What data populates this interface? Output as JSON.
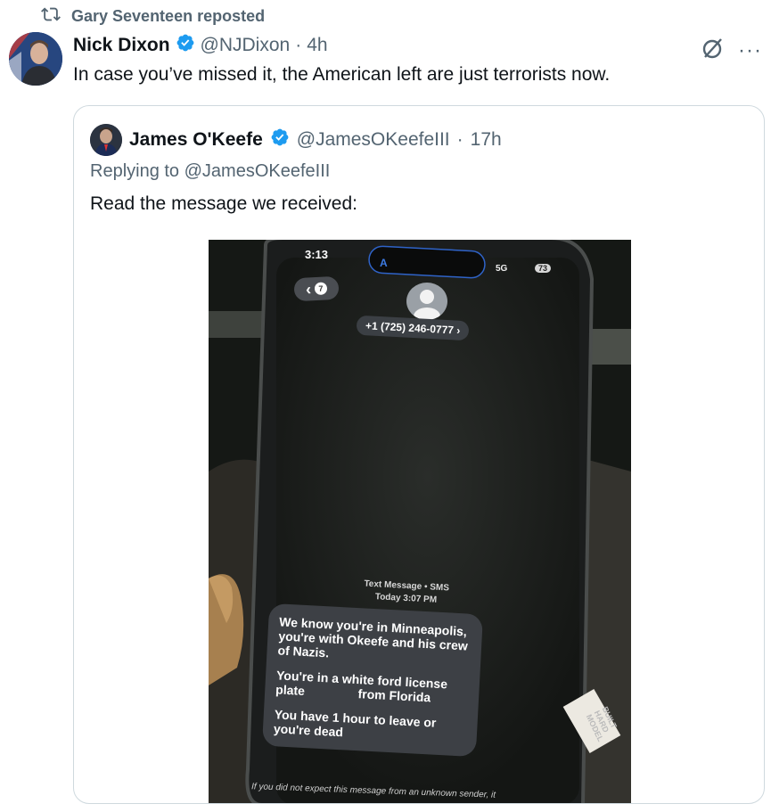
{
  "repost": {
    "label": "Gary Seventeen reposted",
    "icon": "repost-icon"
  },
  "tweet": {
    "author_name": "Nick Dixon",
    "handle": "@NJDixon",
    "separator": "·",
    "time": "4h",
    "text": "In case you’ve missed it, the American left are just terrorists now.",
    "more": "···"
  },
  "quote": {
    "author_name": "James O'Keefe",
    "handle": "@JamesOKeefeIII",
    "separator": "·",
    "time": "17h",
    "replying_prefix": "Replying to",
    "replying_handle": "@JamesOKeefeIII",
    "text": "Read the message we received:"
  },
  "photo": {
    "status_time": "3:13",
    "status_signal": "5G",
    "battery": "73",
    "back_count": "7",
    "phone_number": "+1 (725) 246-0777 ›",
    "meta_line1": "Text Message • SMS",
    "meta_line2": "Today 3:07 PM",
    "message_p1": "We know you're in Minneapolis, you're with Okeefe and his crew of Nazis.",
    "message_p2a": "You're in a white ford license plate",
    "message_p2b": "from Florida",
    "message_p3": "You have 1 hour to leave or you're dead",
    "footer": "If you did not expect this message from an unknown sender, it",
    "side_label": "BUILT HARD MODEL"
  },
  "colors": {
    "verified": "#1d9bf0",
    "secondary_text": "#536471",
    "border": "#cfd9de"
  }
}
